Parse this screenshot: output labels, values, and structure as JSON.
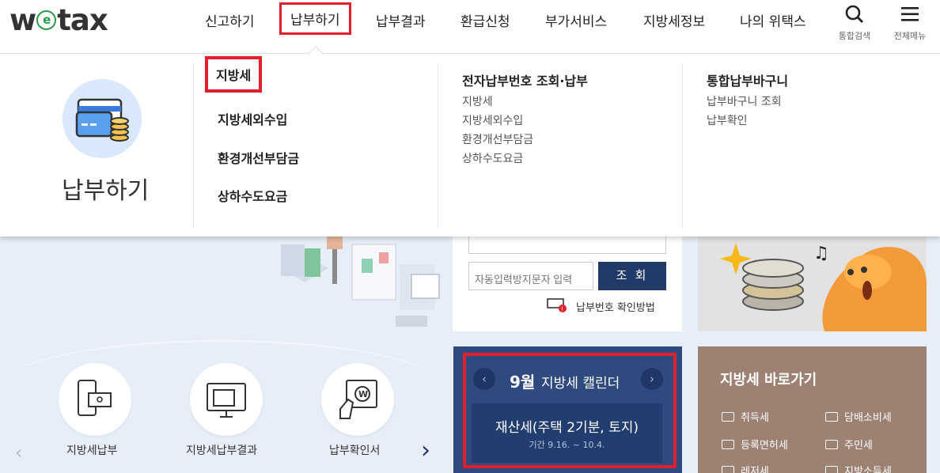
{
  "header": {
    "logo": {
      "w": "w",
      "e": "e",
      "tax": "tax"
    },
    "nav": [
      "신고하기",
      "납부하기",
      "납부결과",
      "환급신청",
      "부가서비스",
      "지방세정보",
      "나의 위택스"
    ],
    "search_label": "통합검색",
    "menu_label": "전체메뉴"
  },
  "mega": {
    "title": "납부하기",
    "sub": [
      "지방세",
      "지방세외수입",
      "환경개선부담금",
      "상하수도요금"
    ],
    "col1": {
      "title": "전자납부번호 조회·납부",
      "links": [
        "지방세",
        "지방세외수입",
        "환경개선부담금",
        "상하수도요금"
      ]
    },
    "col2": {
      "title": "통합납부바구니",
      "links": [
        "납부바구니 조회",
        "납부확인"
      ]
    }
  },
  "lookup": {
    "captcha_placeholder": "자동입력방지문자 입력",
    "button": "조 회",
    "help": "납부번호 확인방법"
  },
  "quick": [
    "지방세납부",
    "지방세납부결과",
    "납부확인서"
  ],
  "calendar": {
    "month": "9월",
    "title": "지방세 캘린더",
    "tax": "재산세(주택 2기분, 토지)",
    "period": "기간 9.16. ~ 10.4."
  },
  "shortcuts": {
    "title": "지방세 바로가기",
    "items": [
      "취득세",
      "담배소비세",
      "등록면허세",
      "주민세",
      "레저세",
      "지방소득세"
    ]
  },
  "colors": {
    "accent": "#e0202a",
    "navy": "#2f4a7e",
    "brown": "#9d8273"
  }
}
